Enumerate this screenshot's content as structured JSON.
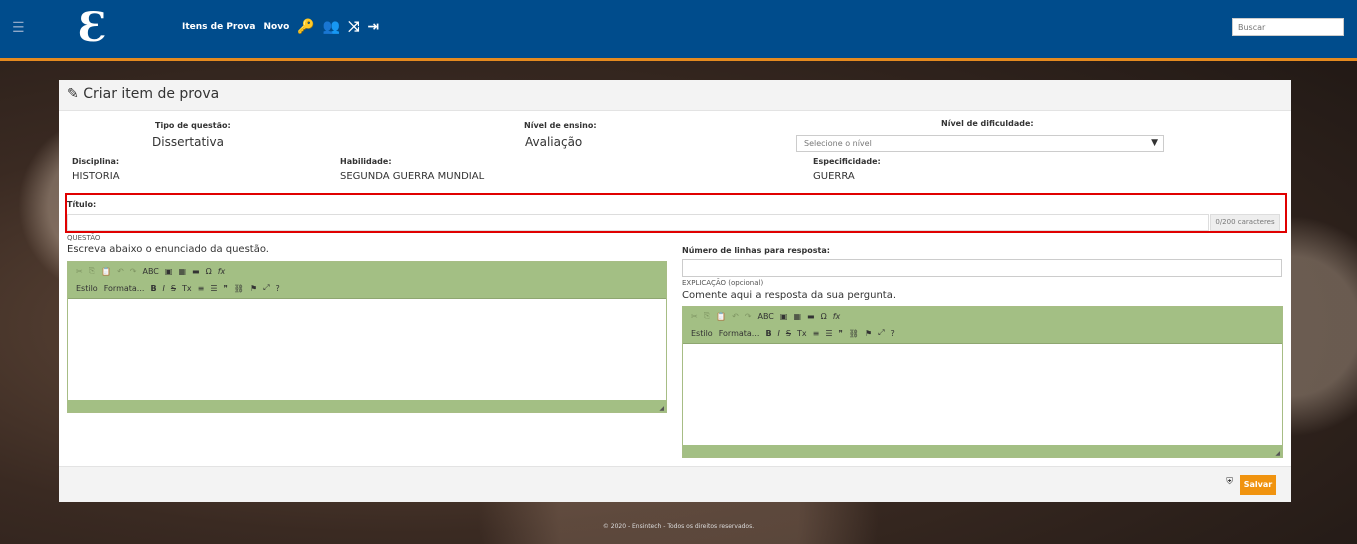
{
  "topbar": {
    "logo": "Ɛ",
    "menu_icon": "hamburger-icon",
    "nav": {
      "itens": "Itens de Prova",
      "novo": "Novo"
    },
    "icons": [
      "key-icon",
      "users-icon",
      "shuffle-icon",
      "logout-icon"
    ],
    "search_placeholder": "Buscar"
  },
  "panel": {
    "title": "Criar item de prova"
  },
  "fields": {
    "tipo_label": "Tipo de questão:",
    "tipo_value": "Dissertativa",
    "nivel_ensino_label": "Nível de ensino:",
    "nivel_ensino_value": "Avaliação",
    "dificuldade_label": "Nível de dificuldade:",
    "dificuldade_placeholder": "Selecione o nível",
    "disciplina_label": "Disciplina:",
    "disciplina_value": "HISTORIA",
    "habilidade_label": "Habilidade:",
    "habilidade_value": "SEGUNDA GUERRA MUNDIAL",
    "especificidade_label": "Especificidade:",
    "especificidade_value": "GUERRA"
  },
  "titulo": {
    "label": "Título:",
    "counter": "0/200 caracteres"
  },
  "questao": {
    "label": "QUESTÃO",
    "hint": "Escreva abaixo o enunciado da questão."
  },
  "linhas": {
    "label": "Número de linhas para resposta:"
  },
  "explicacao": {
    "label": "EXPLICAÇÃO (opcional)",
    "hint": "Comente aqui a resposta da sua pergunta."
  },
  "toolbar": {
    "estilo": "Estilo",
    "formata": "Formata..."
  },
  "actions": {
    "save": "Salvar"
  },
  "footer": {
    "copyright": "© 2020 - Ensintech - Todos os direitos reservados."
  },
  "colors": {
    "topbar": "#004c8c",
    "accent": "#f0930f",
    "editor_toolbar": "#a3bf84",
    "highlight": "#e00000"
  }
}
